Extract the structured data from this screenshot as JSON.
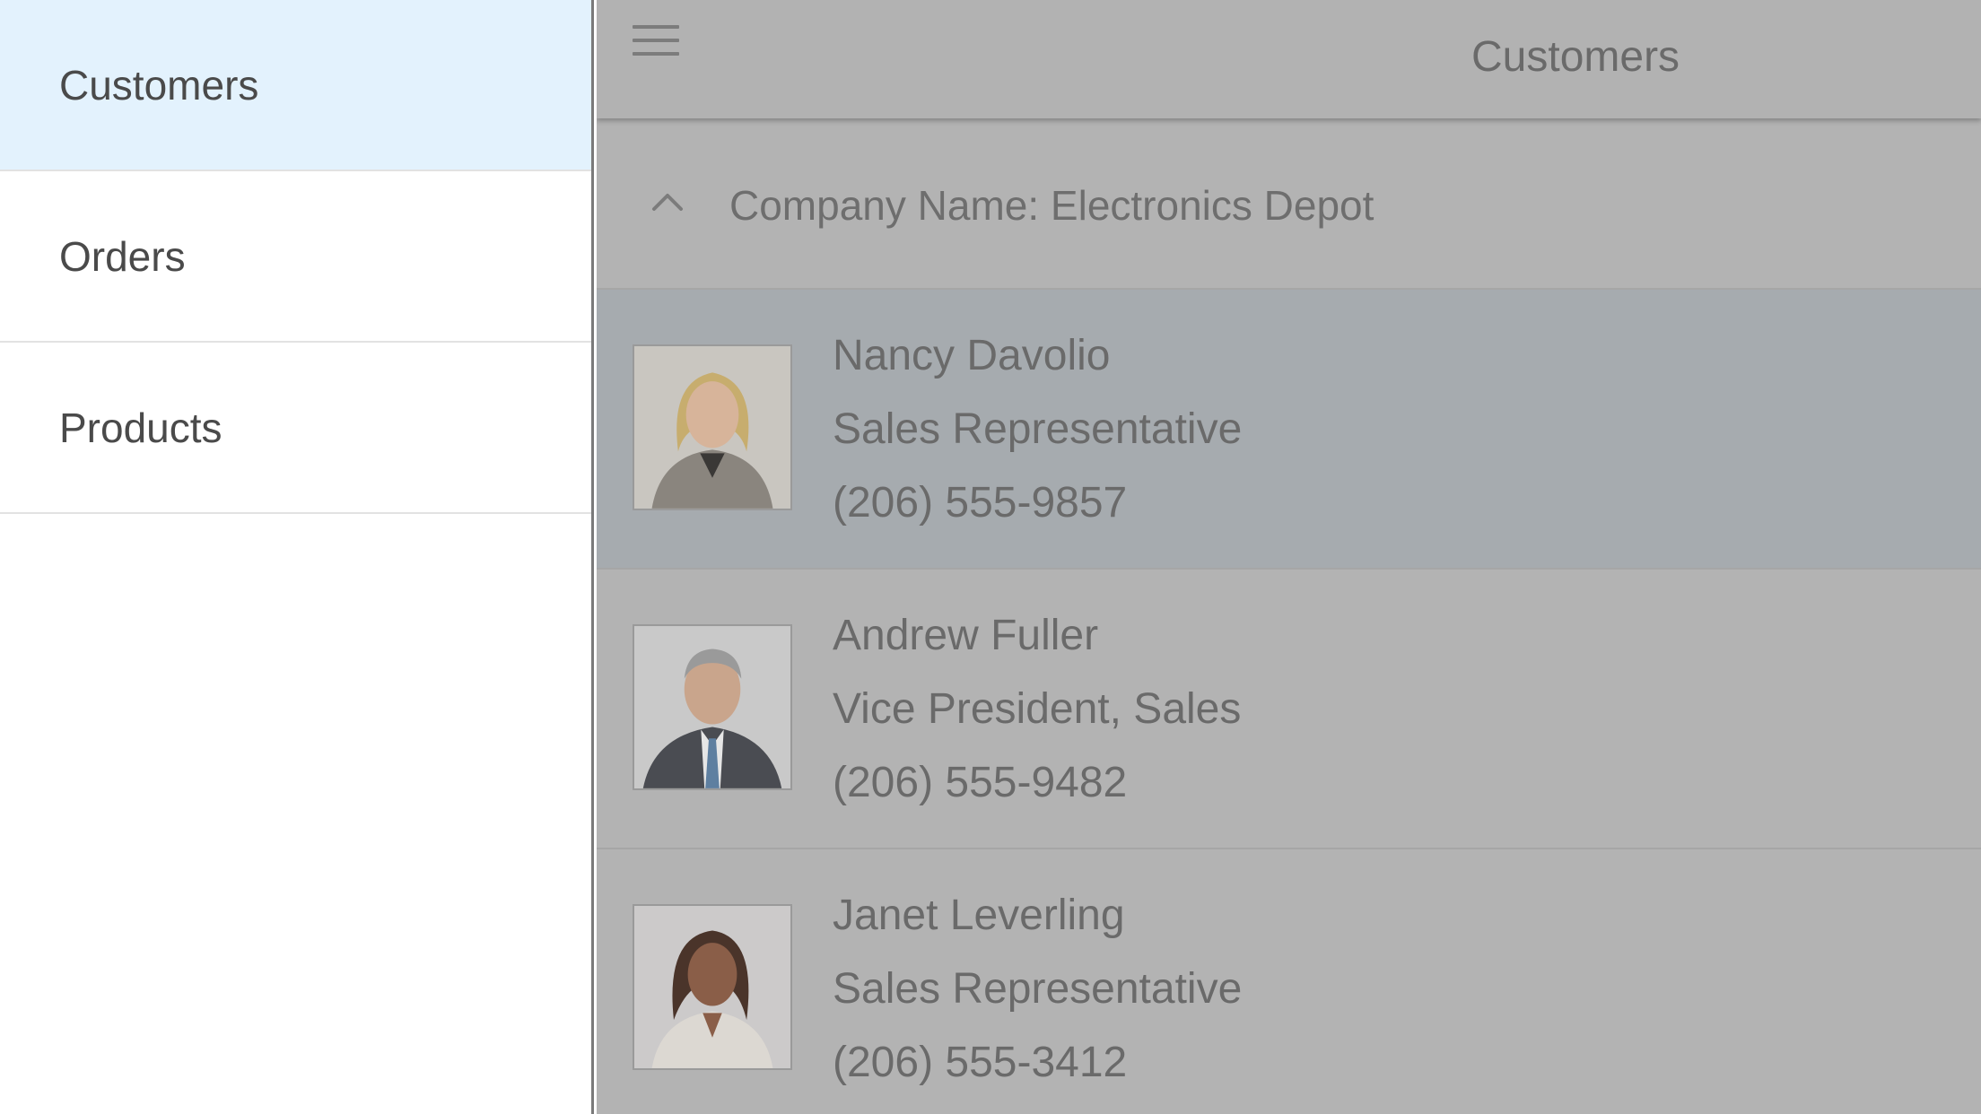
{
  "drawer": {
    "items": [
      {
        "label": "Customers"
      },
      {
        "label": "Orders"
      },
      {
        "label": "Products"
      }
    ]
  },
  "header": {
    "title": "Customers",
    "menu_icon": "hamburger-menu-icon"
  },
  "group": {
    "label": "Company Name: Electronics Depot",
    "icon": "chevron-up-icon"
  },
  "contacts": [
    {
      "name": "Nancy Davolio",
      "title": "Sales Representative",
      "phone": "(206) 555-9857"
    },
    {
      "name": "Andrew Fuller",
      "title": "Vice President, Sales",
      "phone": "(206) 555-9482"
    },
    {
      "name": "Janet Leverling",
      "title": "Sales Representative",
      "phone": "(206) 555-3412"
    }
  ],
  "colors": {
    "selected_drawer_item": "#e3f2fd",
    "overlay_background": "#b3b3b3",
    "selected_row": "#a6abaf"
  }
}
